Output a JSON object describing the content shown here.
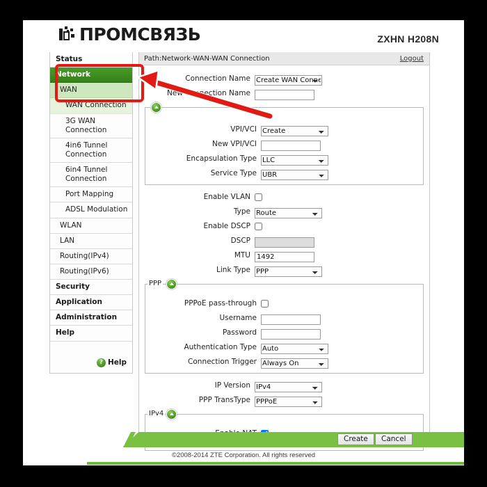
{
  "brand": {
    "logo_text": "ПРОМСВЯЗЬ",
    "logo_mark_icon": "promsvyaz-logo-icon",
    "model": "ZXHN H208N"
  },
  "pathbar": {
    "path": "Path:Network-WAN-WAN Connection",
    "logout": "Logout"
  },
  "sidebar": {
    "items": [
      {
        "label": "Status",
        "level": 0,
        "active": false
      },
      {
        "label": "Network",
        "level": 0,
        "active": true
      },
      {
        "label": "WAN",
        "level": 1,
        "active": true
      },
      {
        "label": "WAN Connection",
        "level": 2,
        "active": true
      },
      {
        "label": "3G WAN Connection",
        "level": 2,
        "active": false
      },
      {
        "label": "4in6 Tunnel Connection",
        "level": 2,
        "active": false
      },
      {
        "label": "6in4 Tunnel Connection",
        "level": 2,
        "active": false
      },
      {
        "label": "Port Mapping",
        "level": 2,
        "active": false
      },
      {
        "label": "ADSL Modulation",
        "level": 2,
        "active": false
      },
      {
        "label": "WLAN",
        "level": 1,
        "active": false
      },
      {
        "label": "LAN",
        "level": 1,
        "active": false
      },
      {
        "label": "Routing(IPv4)",
        "level": 1,
        "active": false
      },
      {
        "label": "Routing(IPv6)",
        "level": 1,
        "active": false
      },
      {
        "label": "Security",
        "level": 0,
        "active": false
      },
      {
        "label": "Application",
        "level": 0,
        "active": false
      },
      {
        "label": "Administration",
        "level": 0,
        "active": false
      },
      {
        "label": "Help",
        "level": 0,
        "active": false
      }
    ],
    "help": {
      "label": "Help",
      "icon": "question-mark-icon"
    }
  },
  "form": {
    "connection_name": {
      "label": "Connection Name",
      "value": "Create WAN Conne"
    },
    "new_connection_name": {
      "label": "New Connection Name",
      "value": ""
    },
    "atm_group": {
      "vpi_vci": {
        "label": "VPI/VCI",
        "value": "Create"
      },
      "new_vpi_vci": {
        "label": "New VPI/VCI",
        "value": ""
      },
      "encapsulation_type": {
        "label": "Encapsulation Type",
        "value": "LLC"
      },
      "service_type": {
        "label": "Service Type",
        "value": "UBR"
      }
    },
    "enable_vlan": {
      "label": "Enable VLAN",
      "checked": false
    },
    "type": {
      "label": "Type",
      "value": "Route"
    },
    "enable_dscp": {
      "label": "Enable DSCP",
      "checked": false
    },
    "dscp": {
      "label": "DSCP",
      "value": "",
      "disabled": true
    },
    "mtu": {
      "label": "MTU",
      "value": "1492"
    },
    "link_type": {
      "label": "Link Type",
      "value": "PPP"
    },
    "ppp_group": {
      "legend": "PPP",
      "pppoe_pass_through": {
        "label": "PPPoE pass-through",
        "checked": false
      },
      "username": {
        "label": "Username",
        "value": ""
      },
      "password": {
        "label": "Password",
        "value": ""
      },
      "authentication_type": {
        "label": "Authentication Type",
        "value": "Auto"
      },
      "connection_trigger": {
        "label": "Connection Trigger",
        "value": "Always On"
      }
    },
    "ip_version": {
      "label": "IP Version",
      "value": "IPv4"
    },
    "ppp_transtype": {
      "label": "PPP TransType",
      "value": "PPPoE"
    },
    "ipv4_group": {
      "legend": "IPv4",
      "enable_nat": {
        "label": "Enable NAT",
        "checked": true
      }
    }
  },
  "buttons": {
    "create": "Create",
    "cancel": "Cancel"
  },
  "footer": {
    "copyright": "©2008-2014 ZTE Corporation. All rights reserved"
  },
  "annotation": {
    "highlight_target": "WAN Connection",
    "color": "#e01b14"
  },
  "colors": {
    "accent_green": "#7ac043",
    "nav_active_green": "#35801a",
    "annotation_red": "#e01b14"
  }
}
